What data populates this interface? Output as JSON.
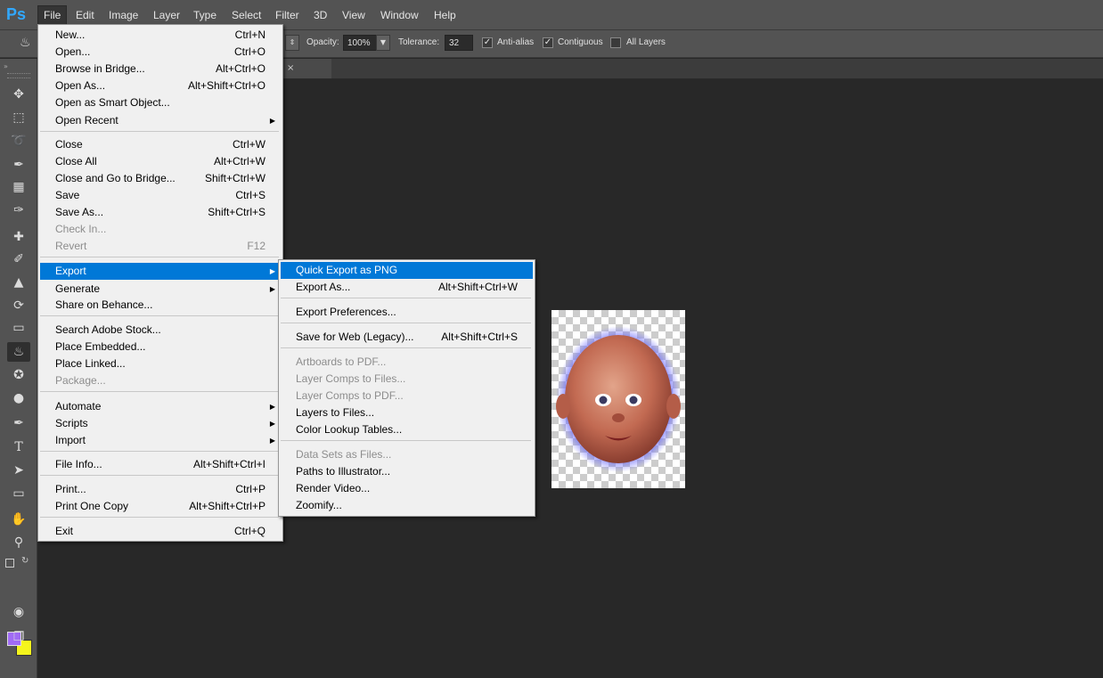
{
  "app": {
    "logo": "Ps"
  },
  "menubar": {
    "items": [
      "File",
      "Edit",
      "Image",
      "Layer",
      "Type",
      "Select",
      "Filter",
      "3D",
      "View",
      "Window",
      "Help"
    ],
    "active": "File"
  },
  "options": {
    "opacity_label": "Opacity:",
    "opacity_value": "100%",
    "tolerance_label": "Tolerance:",
    "tolerance_value": "32",
    "antialias_label": "Anti-alias",
    "contiguous_label": "Contiguous",
    "all_layers_label": "All Layers",
    "antialias_checked": true,
    "contiguous_checked": true,
    "all_layers_checked": false
  },
  "colors": {
    "foreground": "#a06bf5",
    "background": "#f5f51d",
    "highlight": "#0078d7"
  },
  "file_menu": {
    "items": [
      {
        "label": "New...",
        "shortcut": "Ctrl+N"
      },
      {
        "label": "Open...",
        "shortcut": "Ctrl+O"
      },
      {
        "label": "Browse in Bridge...",
        "shortcut": "Alt+Ctrl+O"
      },
      {
        "label": "Open As...",
        "shortcut": "Alt+Shift+Ctrl+O"
      },
      {
        "label": "Open as Smart Object...",
        "shortcut": ""
      },
      {
        "label": "Open Recent",
        "shortcut": "",
        "submenu": true
      },
      {
        "label": "Close",
        "shortcut": "Ctrl+W"
      },
      {
        "label": "Close All",
        "shortcut": "Alt+Ctrl+W"
      },
      {
        "label": "Close and Go to Bridge...",
        "shortcut": "Shift+Ctrl+W"
      },
      {
        "label": "Save",
        "shortcut": "Ctrl+S"
      },
      {
        "label": "Save As...",
        "shortcut": "Shift+Ctrl+S"
      },
      {
        "label": "Check In...",
        "shortcut": "",
        "disabled": true
      },
      {
        "label": "Revert",
        "shortcut": "F12",
        "disabled": true
      },
      {
        "label": "Export",
        "shortcut": "",
        "submenu": true,
        "highlighted": true
      },
      {
        "label": "Generate",
        "shortcut": "",
        "submenu": true
      },
      {
        "label": "Share on Behance...",
        "shortcut": ""
      },
      {
        "label": "Search Adobe Stock...",
        "shortcut": ""
      },
      {
        "label": "Place Embedded...",
        "shortcut": ""
      },
      {
        "label": "Place Linked...",
        "shortcut": ""
      },
      {
        "label": "Package...",
        "shortcut": "",
        "disabled": true
      },
      {
        "label": "Automate",
        "shortcut": "",
        "submenu": true
      },
      {
        "label": "Scripts",
        "shortcut": "",
        "submenu": true
      },
      {
        "label": "Import",
        "shortcut": "",
        "submenu": true
      },
      {
        "label": "File Info...",
        "shortcut": "Alt+Shift+Ctrl+I"
      },
      {
        "label": "Print...",
        "shortcut": "Ctrl+P"
      },
      {
        "label": "Print One Copy",
        "shortcut": "Alt+Shift+Ctrl+P"
      },
      {
        "label": "Exit",
        "shortcut": "Ctrl+Q"
      }
    ]
  },
  "export_menu": {
    "items": [
      {
        "label": "Quick Export as PNG",
        "shortcut": "",
        "highlighted": true
      },
      {
        "label": "Export As...",
        "shortcut": "Alt+Shift+Ctrl+W"
      },
      {
        "label": "Export Preferences...",
        "shortcut": ""
      },
      {
        "label": "Save for Web (Legacy)...",
        "shortcut": "Alt+Shift+Ctrl+S"
      },
      {
        "label": "Artboards to PDF...",
        "shortcut": "",
        "disabled": true
      },
      {
        "label": "Layer Comps to Files...",
        "shortcut": "",
        "disabled": true
      },
      {
        "label": "Layer Comps to PDF...",
        "shortcut": "",
        "disabled": true
      },
      {
        "label": "Layers to Files...",
        "shortcut": ""
      },
      {
        "label": "Color Lookup Tables...",
        "shortcut": ""
      },
      {
        "label": "Data Sets as Files...",
        "shortcut": "",
        "disabled": true
      },
      {
        "label": "Paths to Illustrator...",
        "shortcut": ""
      },
      {
        "label": "Render Video...",
        "shortcut": ""
      },
      {
        "label": "Zoomify...",
        "shortcut": ""
      }
    ]
  },
  "tools": [
    "move-icon",
    "marquee-icon",
    "lasso-icon",
    "quick-select-icon",
    "crop-icon",
    "eyedropper-icon",
    "healing-icon",
    "brush-icon",
    "stamp-icon",
    "history-brush-icon",
    "eraser-icon",
    "paint-bucket-icon",
    "blur-icon",
    "dodge-icon",
    "pen-icon",
    "type-icon",
    "path-select-icon",
    "shape-icon",
    "hand-icon",
    "zoom-icon"
  ]
}
